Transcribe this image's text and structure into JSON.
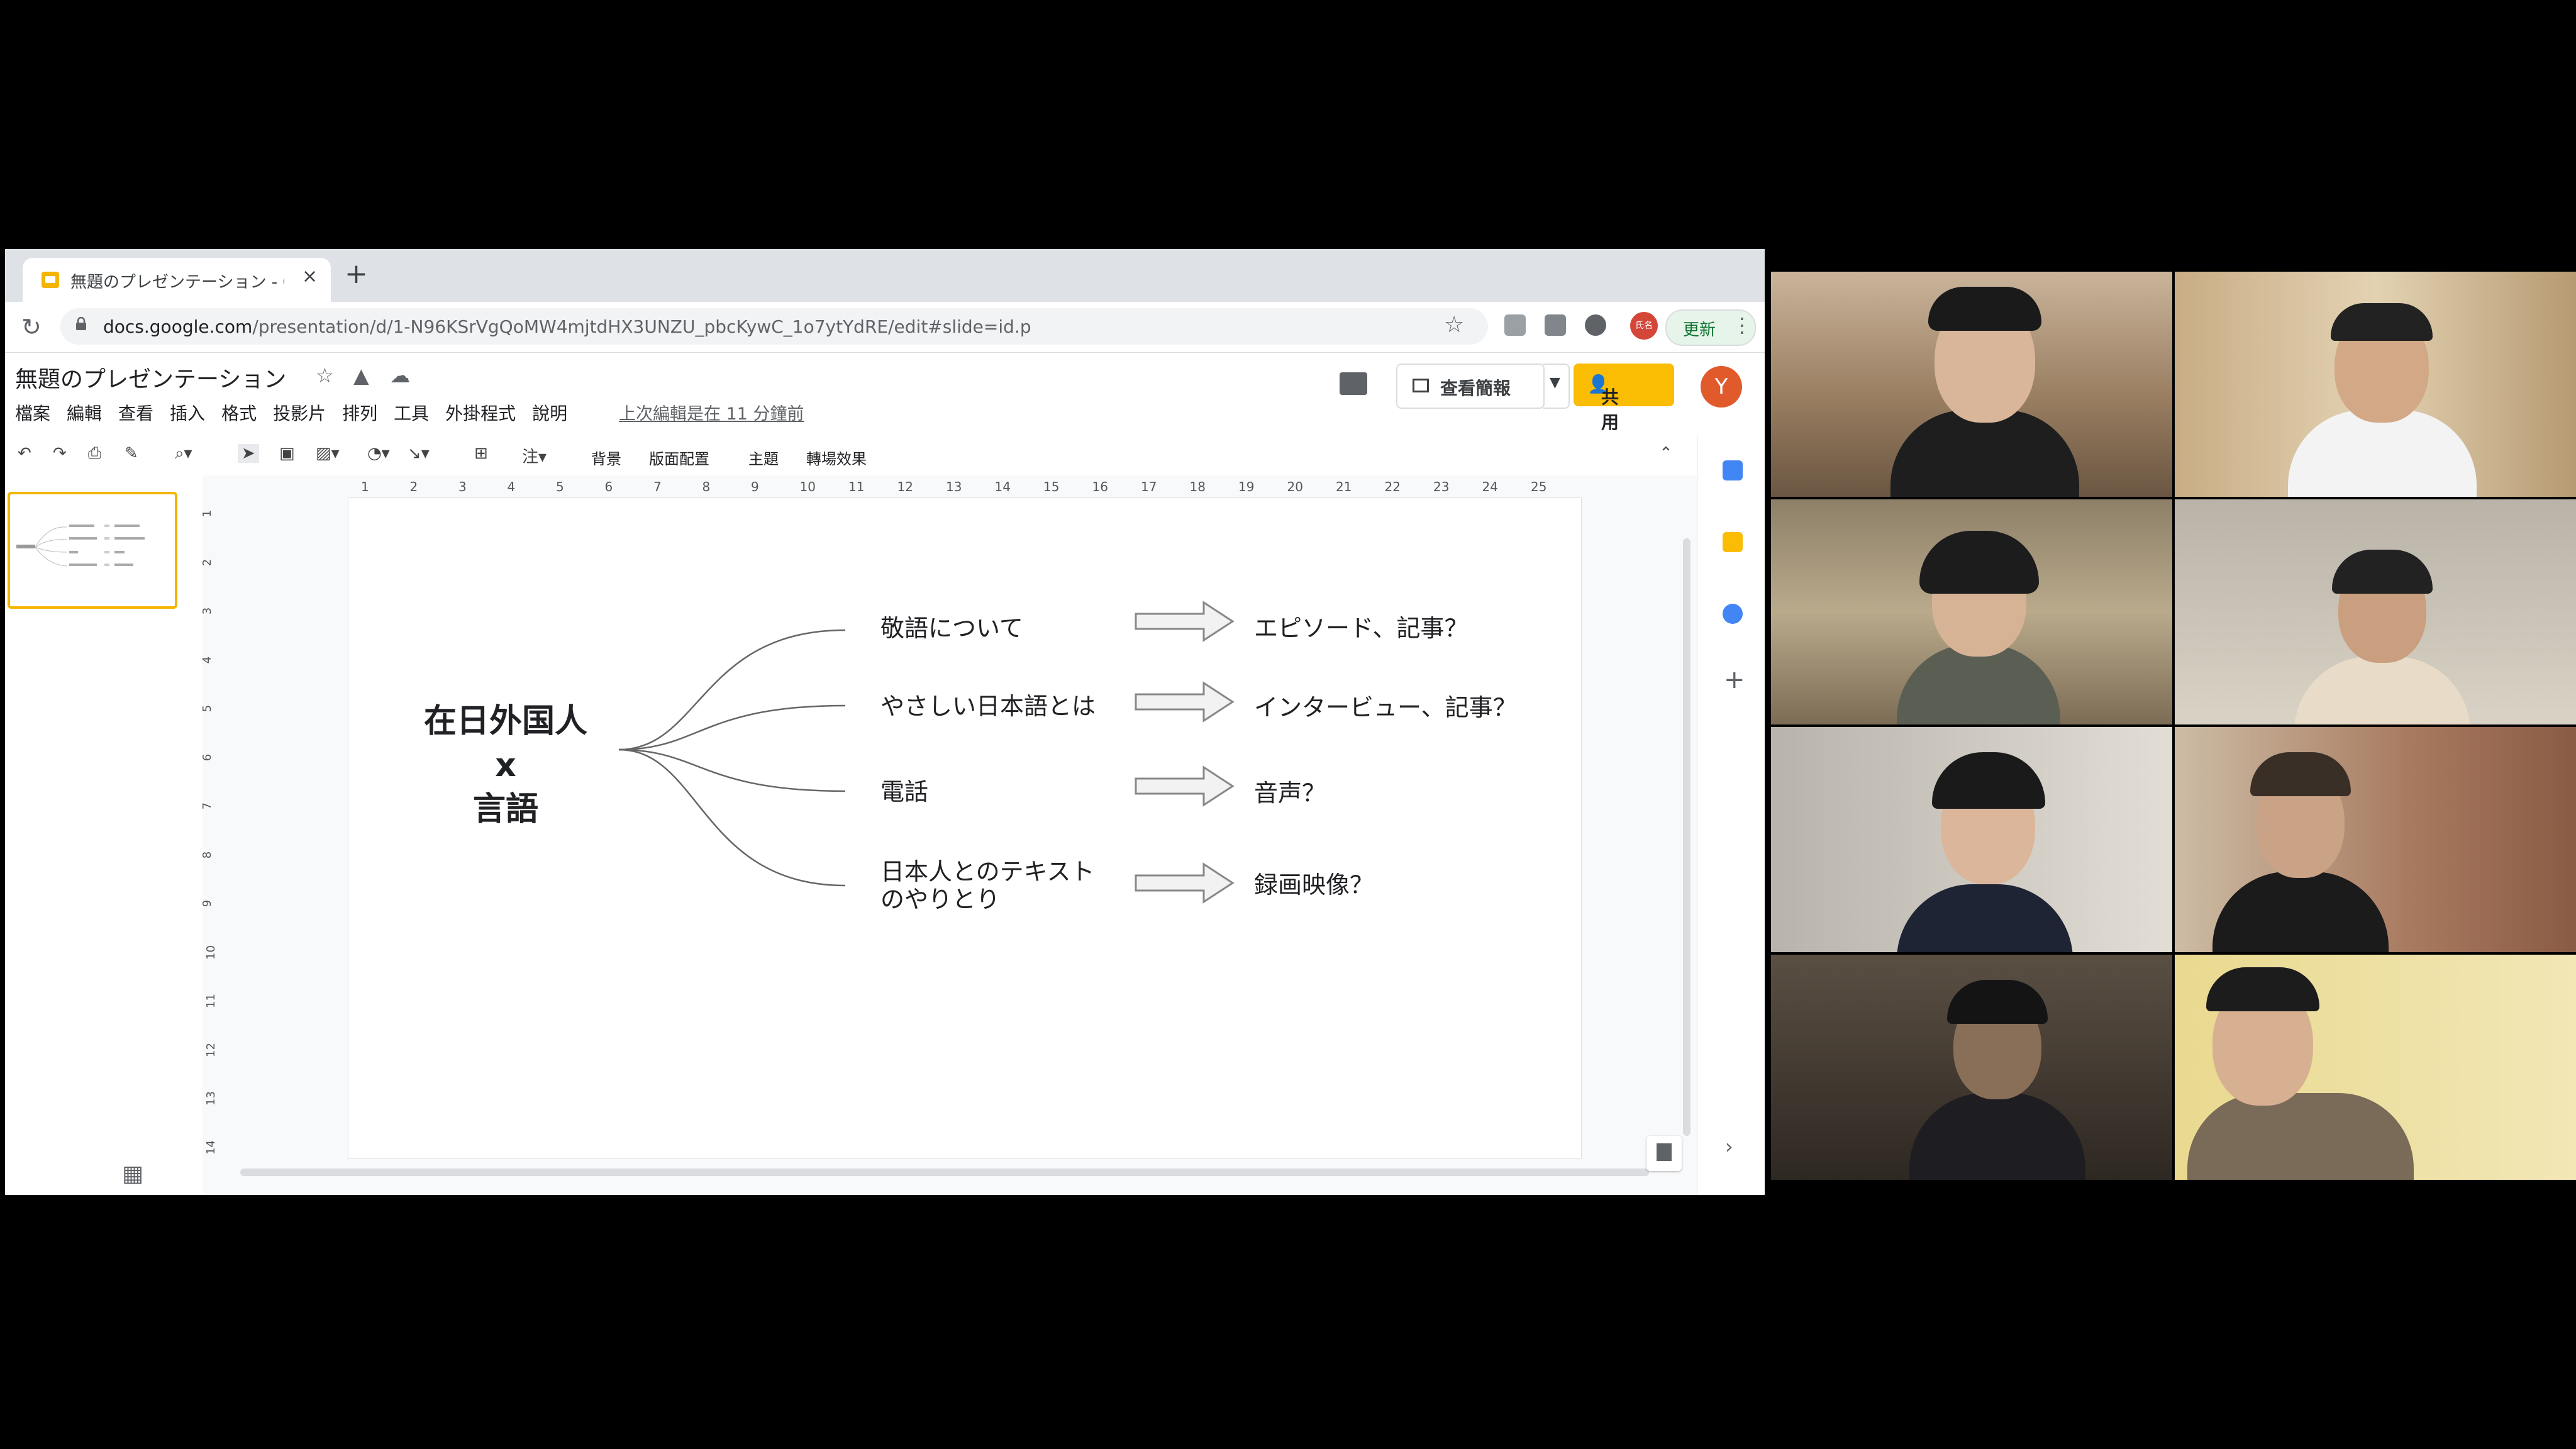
{
  "browser": {
    "tab_title": "無題のプレゼンテーション - Go",
    "tab_close": "×",
    "new_tab": "+",
    "url_host": "docs.google.com",
    "url_path": "/presentation/d/1-N96KSrVgQoMW4mjtdHX3UNZU_pbcKywC_1o7ytYdRE/edit#slide=id.p",
    "profile_ext_label": "氏名",
    "update_label": "更新",
    "menu_dots": "⋮"
  },
  "app": {
    "doc_title": "無題のプレゼンテーション",
    "menus": [
      "檔案",
      "編輯",
      "查看",
      "插入",
      "格式",
      "投影片",
      "排列",
      "工具",
      "外掛程式",
      "說明"
    ],
    "last_edit": "上次編輯是在 11 分鐘前",
    "present_label": "查看簡報",
    "share_label": "共用",
    "avatar_letter": "Y",
    "accent_color": "#fbbc04"
  },
  "toolbar": {
    "text_items": [
      "背景",
      "版面配置",
      "主題",
      "轉場效果"
    ],
    "comment_symbol": "注"
  },
  "ruler": {
    "h_ticks": [
      "1",
      "2",
      "3",
      "4",
      "5",
      "6",
      "7",
      "8",
      "9",
      "10",
      "11",
      "12",
      "13",
      "14",
      "15",
      "16",
      "17",
      "18",
      "19",
      "20",
      "21",
      "22",
      "23",
      "24",
      "25"
    ],
    "v_ticks": [
      "1",
      "2",
      "3",
      "4",
      "5",
      "6",
      "7",
      "8",
      "9",
      "10",
      "11",
      "12",
      "13",
      "14"
    ]
  },
  "slide": {
    "main_topic_line1": "在日外国人",
    "main_topic_line2": "x",
    "main_topic_line3": "言語",
    "rows": [
      {
        "topic": "敬語について",
        "result": "エピソード、記事？"
      },
      {
        "topic": "やさしい日本語とは",
        "result": "インタービュー、記事？"
      },
      {
        "topic": "電話",
        "result": "音声？"
      },
      {
        "topic": "日本人とのテキスト",
        "topic2": "のやりとり",
        "result": "録画映像？"
      }
    ]
  }
}
